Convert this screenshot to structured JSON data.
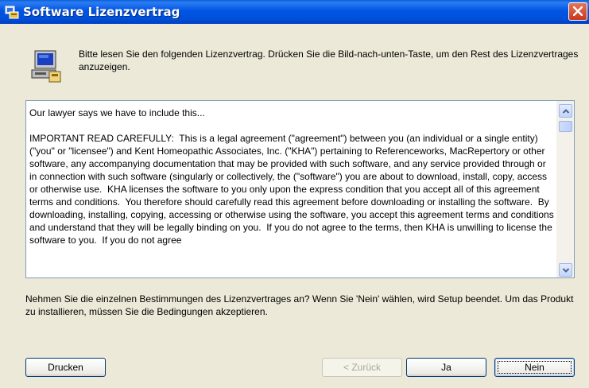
{
  "window": {
    "title": "Software Lizenzvertrag"
  },
  "header": {
    "instruction": "Bitte lesen Sie den folgenden Lizenzvertrag. Drücken Sie die Bild-nach-unten-Taste, um den Rest des Lizenzvertrages anzuzeigen."
  },
  "license": {
    "text": "Our lawyer says we have to include this...\n\nIMPORTANT READ CAREFULLY:  This is a legal agreement (\"agreement\") between you (an individual or a single entity) (\"you\" or \"licensee\") and Kent Homeopathic Associates, Inc. (\"KHA\") pertaining to Referenceworks, MacRepertory or other software, any accompanying documentation that may be provided with such software, and any service provided through or in connection with such software (singularly or collectively, the (\"software\") you are about to download, install, copy, access or otherwise use.  KHA licenses the software to you only upon the express condition that you accept all of this agreement terms and conditions.  You therefore should carefully read this agreement before downloading or installing the software.  By downloading, installing, copying, accessing or otherwise using the software, you accept this agreement terms and conditions and understand that they will be legally binding on you.  If you do not agree to the terms, then KHA is unwilling to license the software to you.  If you do not agree"
  },
  "question": "Nehmen Sie die einzelnen Bestimmungen des Lizenzvertrages an? Wenn Sie 'Nein' wählen, wird Setup beendet. Um das Produkt zu installieren, müssen Sie die Bedingungen akzeptieren.",
  "buttons": {
    "print": "Drucken",
    "back": "< Zurück",
    "yes": "Ja",
    "no": "Nein"
  },
  "colors": {
    "titlebar": "#0055e5",
    "close": "#d6492b",
    "dialog_bg": "#ece9d8",
    "text_border": "#7f9db9"
  },
  "icons": {
    "title": "setup-icon",
    "close": "close-icon",
    "header": "computer-setup-icon",
    "scroll_up": "scroll-up-arrow-icon",
    "scroll_down": "scroll-down-arrow-icon"
  }
}
